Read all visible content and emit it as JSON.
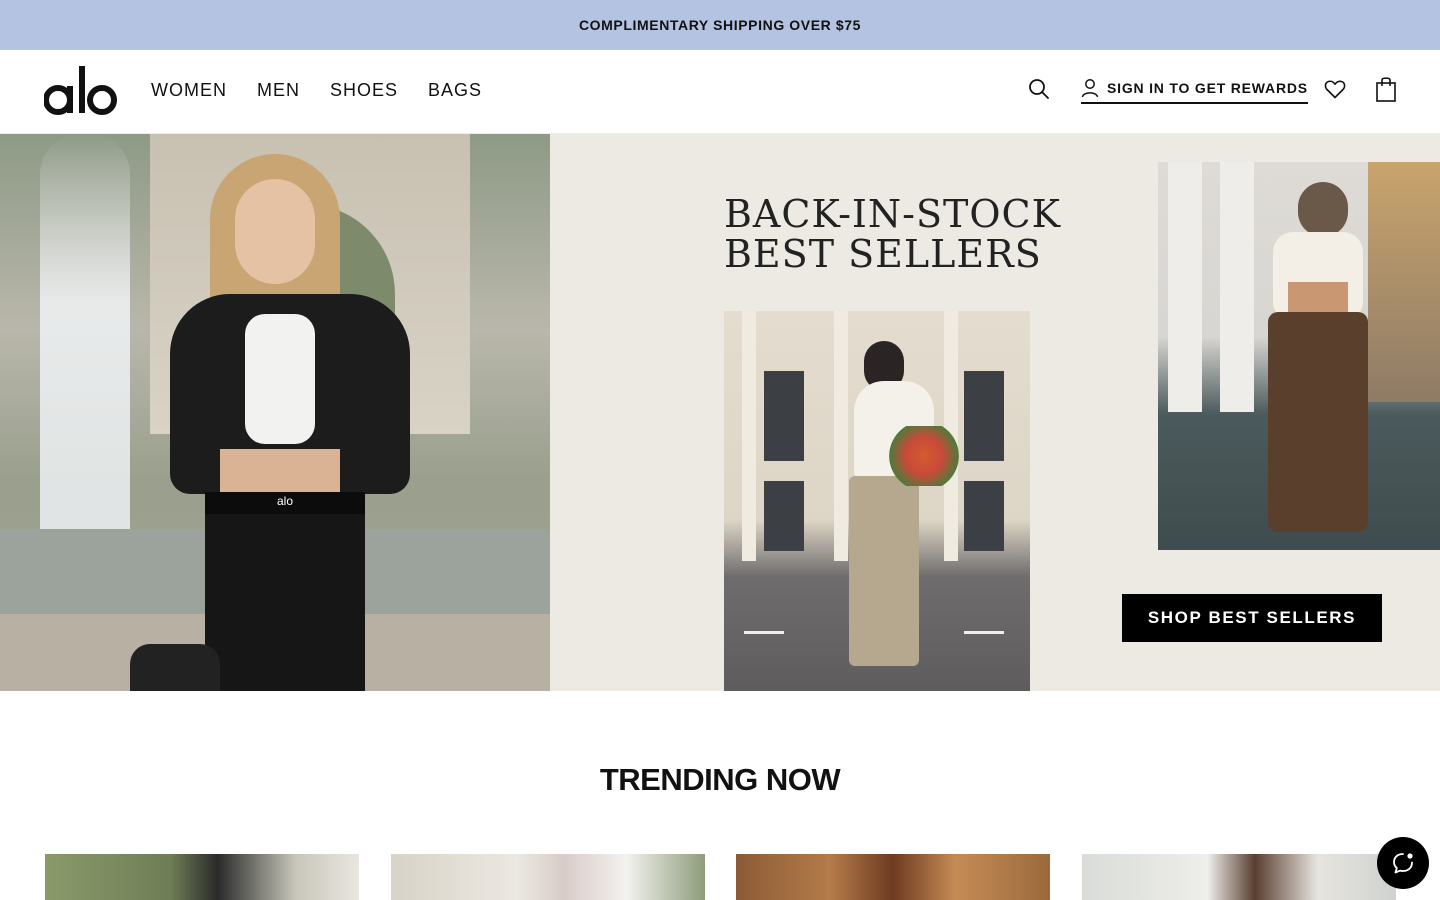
{
  "promo": {
    "text": "COMPLIMENTARY SHIPPING OVER $75"
  },
  "header": {
    "logo_text": "alo",
    "nav": [
      {
        "label": "WOMEN"
      },
      {
        "label": "MEN"
      },
      {
        "label": "SHOES"
      },
      {
        "label": "BAGS"
      }
    ],
    "signin_label": "SIGN IN TO GET REWARDS",
    "icons": [
      "search-icon",
      "user-icon",
      "heart-icon",
      "shopping-bag-icon"
    ]
  },
  "hero": {
    "title_line1": "BACK-IN-STOCK",
    "title_line2": "BEST SELLERS",
    "cta_label": "SHOP BEST SELLERS",
    "waistband_logo": "alo"
  },
  "trending": {
    "title": "TRENDING NOW",
    "tiles": 4
  },
  "chat": {
    "icon": "chat-icon"
  },
  "colors": {
    "promo_bg": "#b4c3e2",
    "hero_bg": "#eceae3",
    "cta_bg": "#000000",
    "cta_text": "#ffffff"
  }
}
